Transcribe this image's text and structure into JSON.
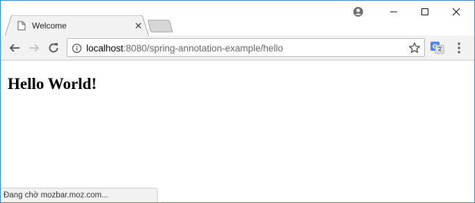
{
  "tab": {
    "title": "Welcome",
    "close_glyph": "✕"
  },
  "toolbar": {
    "url_host": "localhost",
    "url_rest": ":8080/spring-annotation-example/hello"
  },
  "page": {
    "heading": "Hello World!"
  },
  "status": {
    "text": "Đang chờ mozbar.moz.com..."
  },
  "icons": {
    "tab_favicon": "page-icon",
    "profile": "account-icon",
    "back": "back-arrow-icon",
    "forward": "forward-arrow-icon",
    "reload": "reload-icon",
    "info": "info-icon",
    "bookmark": "star-icon",
    "translate": "google-translate-icon",
    "menu": "kebab-menu-icon",
    "minimize": "minimize-icon",
    "maximize": "maximize-icon",
    "close": "close-icon"
  },
  "colors": {
    "window_border": "#3c84c8",
    "toolbar_bg": "#f2f2f2",
    "translate_blue": "#4a86e8"
  }
}
